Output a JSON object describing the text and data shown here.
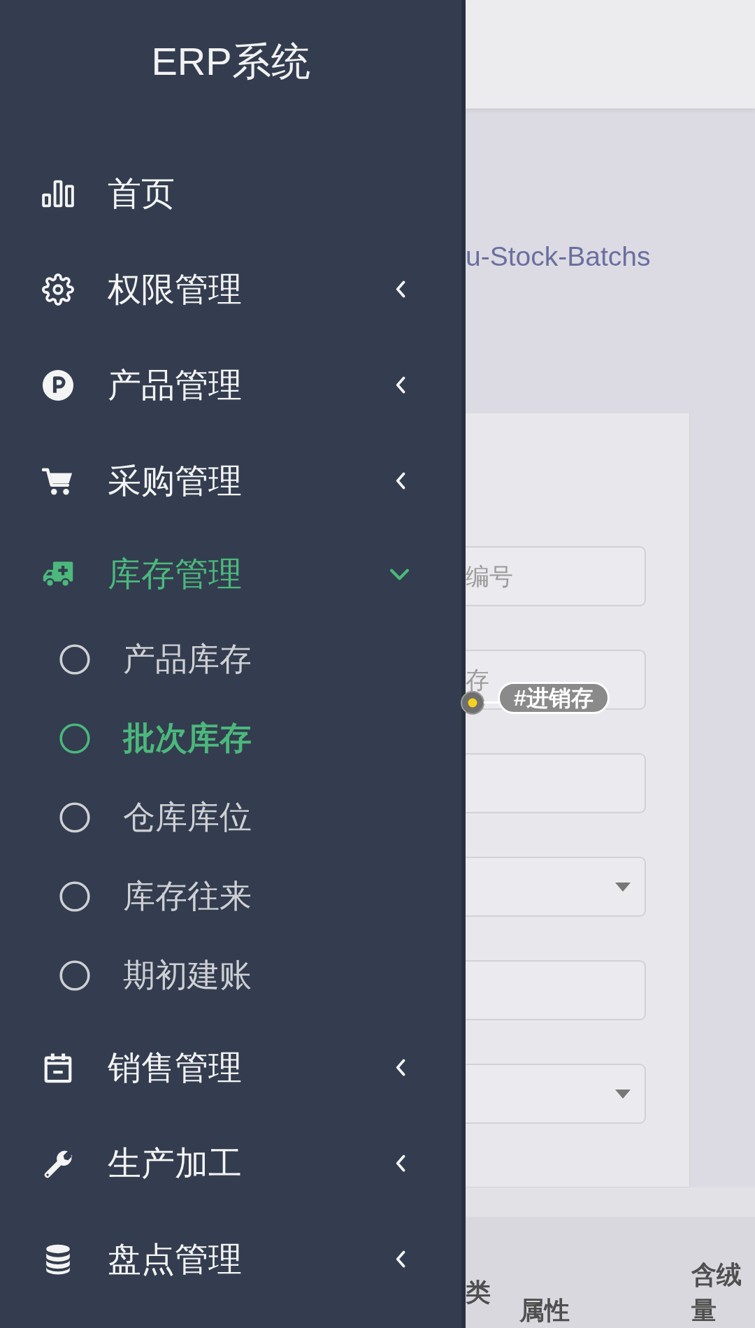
{
  "sidebar": {
    "title": "ERP系统",
    "items": [
      {
        "label": "首页",
        "selected": false
      },
      {
        "label": "权限管理",
        "selected": false,
        "expanded": false
      },
      {
        "label": "产品管理",
        "selected": false,
        "expanded": false
      },
      {
        "label": "采购管理",
        "selected": false,
        "expanded": false
      },
      {
        "label": "库存管理",
        "selected": true,
        "expanded": true,
        "children": [
          {
            "label": "产品库存",
            "selected": false
          },
          {
            "label": "批次库存",
            "selected": true
          },
          {
            "label": "仓库库位",
            "selected": false
          },
          {
            "label": "库存往来",
            "selected": false
          },
          {
            "label": "期初建账",
            "selected": false
          }
        ]
      },
      {
        "label": "销售管理",
        "selected": false,
        "expanded": false
      },
      {
        "label": "生产加工",
        "selected": false,
        "expanded": false
      },
      {
        "label": "盘点管理",
        "selected": false,
        "expanded": false
      }
    ]
  },
  "breadcrumb": "u-Stock-Batchs",
  "form": {
    "fields": [
      {
        "kind": "input",
        "placeholder": "编号"
      },
      {
        "kind": "input",
        "placeholder": "存"
      },
      {
        "kind": "input"
      },
      {
        "kind": "select"
      },
      {
        "kind": "input"
      },
      {
        "kind": "select"
      }
    ]
  },
  "table": {
    "columns": [
      "类",
      "属性",
      "含绒量"
    ]
  },
  "tag": {
    "label": "#进销存"
  }
}
